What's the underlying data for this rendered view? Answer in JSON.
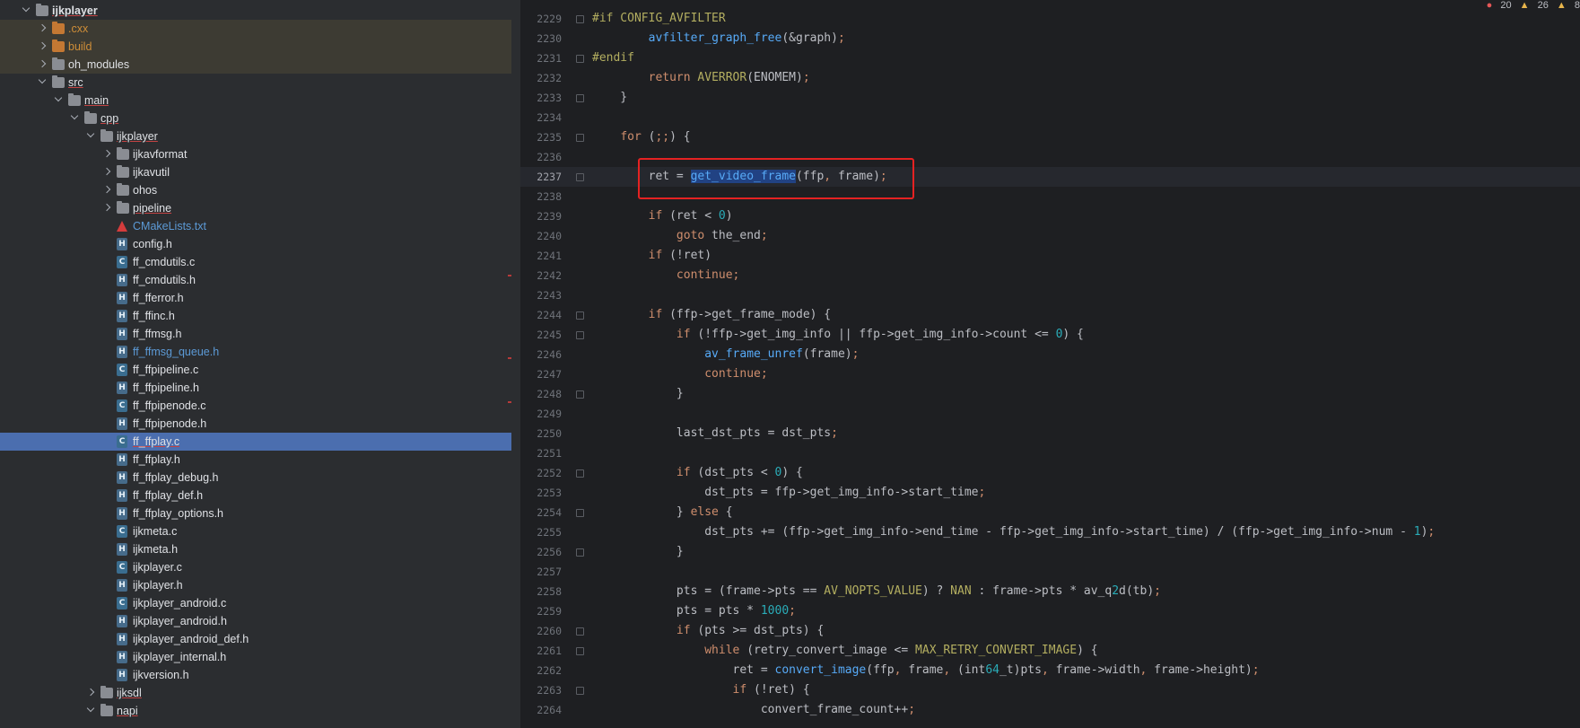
{
  "project_tree": {
    "items": [
      {
        "label": "ijkplayer",
        "icon": "folder-icon",
        "state": "expanded"
      },
      {
        "label": ".cxx",
        "icon": "folder-icon",
        "state": "collapsed"
      },
      {
        "label": "build",
        "icon": "folder-icon",
        "state": "collapsed"
      },
      {
        "label": "oh_modules",
        "icon": "folder-icon",
        "state": "collapsed"
      },
      {
        "label": "src",
        "icon": "folder-icon",
        "state": "expanded"
      },
      {
        "label": "main",
        "icon": "folder-icon",
        "state": "expanded"
      },
      {
        "label": "cpp",
        "icon": "folder-icon",
        "state": "expanded"
      },
      {
        "label": "ijkplayer",
        "icon": "folder-icon",
        "state": "expanded"
      },
      {
        "label": "ijkavformat",
        "icon": "folder-icon",
        "state": "collapsed"
      },
      {
        "label": "ijkavutil",
        "icon": "folder-icon",
        "state": "collapsed"
      },
      {
        "label": "ohos",
        "icon": "folder-icon",
        "state": "collapsed"
      },
      {
        "label": "pipeline",
        "icon": "folder-icon",
        "state": "collapsed"
      },
      {
        "label": "CMakeLists.txt",
        "icon": "cmake-icon"
      },
      {
        "label": "config.h",
        "icon": "header-file-icon"
      },
      {
        "label": "ff_cmdutils.c",
        "icon": "c-file-icon"
      },
      {
        "label": "ff_cmdutils.h",
        "icon": "header-file-icon"
      },
      {
        "label": "ff_fferror.h",
        "icon": "header-file-icon"
      },
      {
        "label": "ff_ffinc.h",
        "icon": "header-file-icon"
      },
      {
        "label": "ff_ffmsg.h",
        "icon": "header-file-icon"
      },
      {
        "label": "ff_ffmsg_queue.h",
        "icon": "header-file-icon"
      },
      {
        "label": "ff_ffpipeline.c",
        "icon": "c-file-icon"
      },
      {
        "label": "ff_ffpipeline.h",
        "icon": "header-file-icon"
      },
      {
        "label": "ff_ffpipenode.c",
        "icon": "c-file-icon"
      },
      {
        "label": "ff_ffpipenode.h",
        "icon": "header-file-icon"
      },
      {
        "label": "ff_ffplay.c",
        "icon": "c-file-icon",
        "selected": true
      },
      {
        "label": "ff_ffplay.h",
        "icon": "header-file-icon"
      },
      {
        "label": "ff_ffplay_debug.h",
        "icon": "header-file-icon"
      },
      {
        "label": "ff_ffplay_def.h",
        "icon": "header-file-icon"
      },
      {
        "label": "ff_ffplay_options.h",
        "icon": "header-file-icon"
      },
      {
        "label": "ijkmeta.c",
        "icon": "c-file-icon"
      },
      {
        "label": "ijkmeta.h",
        "icon": "header-file-icon"
      },
      {
        "label": "ijkplayer.c",
        "icon": "c-file-icon"
      },
      {
        "label": "ijkplayer.h",
        "icon": "header-file-icon"
      },
      {
        "label": "ijkplayer_android.c",
        "icon": "c-file-icon"
      },
      {
        "label": "ijkplayer_android.h",
        "icon": "header-file-icon"
      },
      {
        "label": "ijkplayer_android_def.h",
        "icon": "header-file-icon"
      },
      {
        "label": "ijkplayer_internal.h",
        "icon": "header-file-icon"
      },
      {
        "label": "ijkversion.h",
        "icon": "header-file-icon"
      },
      {
        "label": "ijksdl",
        "icon": "folder-icon",
        "state": "collapsed"
      },
      {
        "label": "napi",
        "icon": "folder-icon",
        "state": "expanded"
      }
    ]
  },
  "status": {
    "errors": "20",
    "warnings": "26",
    "weak_warnings": "8"
  },
  "editor": {
    "lines": [
      {
        "no": "2229",
        "text": "#if CONFIG_AVFILTER"
      },
      {
        "no": "2230",
        "text": "        avfilter_graph_free(&graph);"
      },
      {
        "no": "2231",
        "text": "#endif"
      },
      {
        "no": "2232",
        "text": "        return AVERROR(ENOMEM);"
      },
      {
        "no": "2233",
        "text": "    }"
      },
      {
        "no": "2234",
        "text": ""
      },
      {
        "no": "2235",
        "text": "    for (;;) {"
      },
      {
        "no": "2236",
        "text": ""
      },
      {
        "no": "2237",
        "text": "        ret = get_video_frame(ffp, frame);"
      },
      {
        "no": "2238",
        "text": ""
      },
      {
        "no": "2239",
        "text": "        if (ret < 0)"
      },
      {
        "no": "2240",
        "text": "            goto the_end;"
      },
      {
        "no": "2241",
        "text": "        if (!ret)"
      },
      {
        "no": "2242",
        "text": "            continue;"
      },
      {
        "no": "2243",
        "text": ""
      },
      {
        "no": "2244",
        "text": "        if (ffp->get_frame_mode) {"
      },
      {
        "no": "2245",
        "text": "            if (!ffp->get_img_info || ffp->get_img_info->count <= 0) {"
      },
      {
        "no": "2246",
        "text": "                av_frame_unref(frame);"
      },
      {
        "no": "2247",
        "text": "                continue;"
      },
      {
        "no": "2248",
        "text": "            }"
      },
      {
        "no": "2249",
        "text": ""
      },
      {
        "no": "2250",
        "text": "            last_dst_pts = dst_pts;"
      },
      {
        "no": "2251",
        "text": ""
      },
      {
        "no": "2252",
        "text": "            if (dst_pts < 0) {"
      },
      {
        "no": "2253",
        "text": "                dst_pts = ffp->get_img_info->start_time;"
      },
      {
        "no": "2254",
        "text": "            } else {"
      },
      {
        "no": "2255",
        "text": "                dst_pts += (ffp->get_img_info->end_time - ffp->get_img_info->start_time) / (ffp->get_img_info->num - 1);"
      },
      {
        "no": "2256",
        "text": "            }"
      },
      {
        "no": "2257",
        "text": ""
      },
      {
        "no": "2258",
        "text": "            pts = (frame->pts == AV_NOPTS_VALUE) ? NAN : frame->pts * av_q2d(tb);"
      },
      {
        "no": "2259",
        "text": "            pts = pts * 1000;"
      },
      {
        "no": "2260",
        "text": "            if (pts >= dst_pts) {"
      },
      {
        "no": "2261",
        "text": "                while (retry_convert_image <= MAX_RETRY_CONVERT_IMAGE) {"
      },
      {
        "no": "2262",
        "text": "                    ret = convert_image(ffp, frame, (int64_t)pts, frame->width, frame->height);"
      },
      {
        "no": "2263",
        "text": "                    if (!ret) {"
      },
      {
        "no": "2264",
        "text": "                        convert_frame_count++;"
      }
    ]
  }
}
